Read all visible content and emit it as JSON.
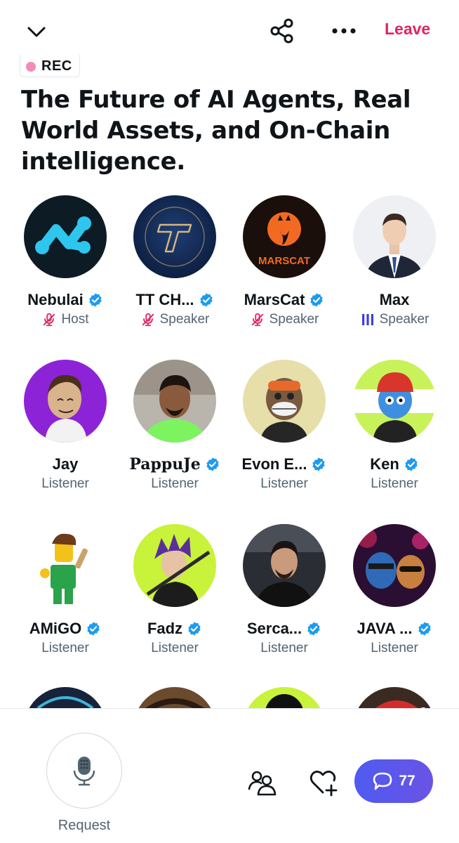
{
  "header": {
    "leave_label": "Leave"
  },
  "rec_badge": {
    "label": "REC"
  },
  "space": {
    "title": "The Future of AI Agents, Real World Assets, and On-Chain intelligence."
  },
  "participants": [
    {
      "name": "Nebulai",
      "verified": true,
      "role": "Host",
      "mic": "muted"
    },
    {
      "name": "TT CH...",
      "verified": true,
      "role": "Speaker",
      "mic": "muted"
    },
    {
      "name": "MarsCat",
      "verified": true,
      "role": "Speaker",
      "mic": "muted"
    },
    {
      "name": "Max",
      "verified": false,
      "role": "Speaker",
      "mic": "speaking"
    },
    {
      "name": "Jay",
      "verified": false,
      "role": "Listener"
    },
    {
      "name": "PappuJe",
      "verified": true,
      "role": "Listener"
    },
    {
      "name": "Evon E...",
      "verified": true,
      "role": "Listener"
    },
    {
      "name": "Ken",
      "verified": true,
      "role": "Listener"
    },
    {
      "name": "AMiGO",
      "verified": true,
      "role": "Listener"
    },
    {
      "name": "Fadz",
      "verified": true,
      "role": "Listener"
    },
    {
      "name": "Serca...",
      "verified": true,
      "role": "Listener"
    },
    {
      "name": "JAVA ...",
      "verified": true,
      "role": "Listener"
    }
  ],
  "avatar_text": {
    "marscat_logo": "MARSCAT"
  },
  "bottom": {
    "request_label": "Request",
    "comments_count": "77"
  },
  "colors": {
    "leave": "#e0245e",
    "verified": "#1d9bf0",
    "muted_mic": "#e0245e",
    "speaking": "#3b3fd8",
    "comments_bg": "#5b57ec"
  },
  "icons": {
    "back": "chevron-down-icon",
    "share": "share-icon",
    "more": "more-dots-icon",
    "request": "microphone-icon",
    "people": "people-icon",
    "heart": "heart-plus-icon",
    "comments": "comment-bubble-icon"
  }
}
